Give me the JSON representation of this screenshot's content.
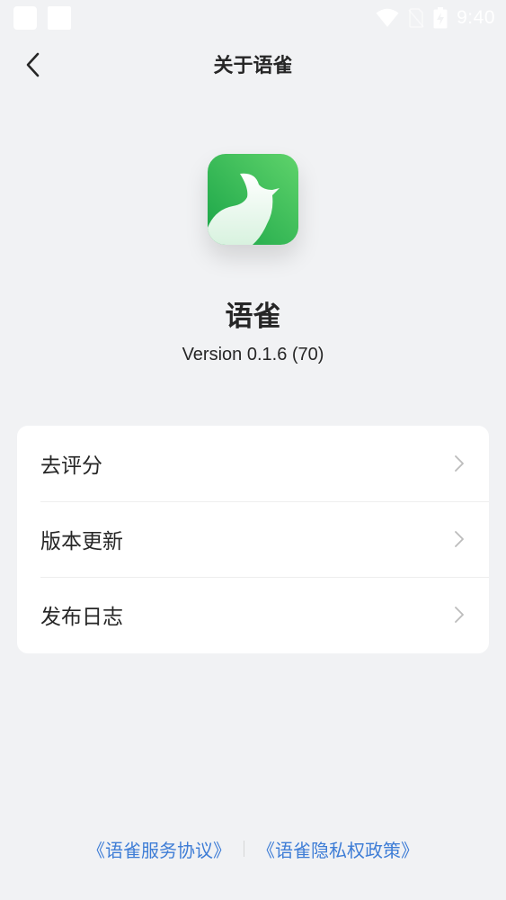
{
  "status_bar": {
    "time": "9:40"
  },
  "header": {
    "title": "关于语雀"
  },
  "app": {
    "name": "语雀",
    "version": "Version 0.1.6 (70)"
  },
  "menu": {
    "items": [
      {
        "label": "去评分"
      },
      {
        "label": "版本更新"
      },
      {
        "label": "发布日志"
      }
    ]
  },
  "footer": {
    "service_agreement": "《语雀服务协议》",
    "privacy_policy": "《语雀隐私权政策》"
  },
  "colors": {
    "background": "#f1f2f4",
    "card": "#ffffff",
    "text": "#262626",
    "link": "#3e7dd6",
    "brand_green": "#2fb84c"
  },
  "icons": {
    "back": "chevron-left-icon",
    "menu_arrow": "chevron-right-icon",
    "wifi": "wifi-icon",
    "no_sim": "no-sim-icon",
    "battery": "battery-charging-icon",
    "logo": "yuque-bird-logo"
  }
}
